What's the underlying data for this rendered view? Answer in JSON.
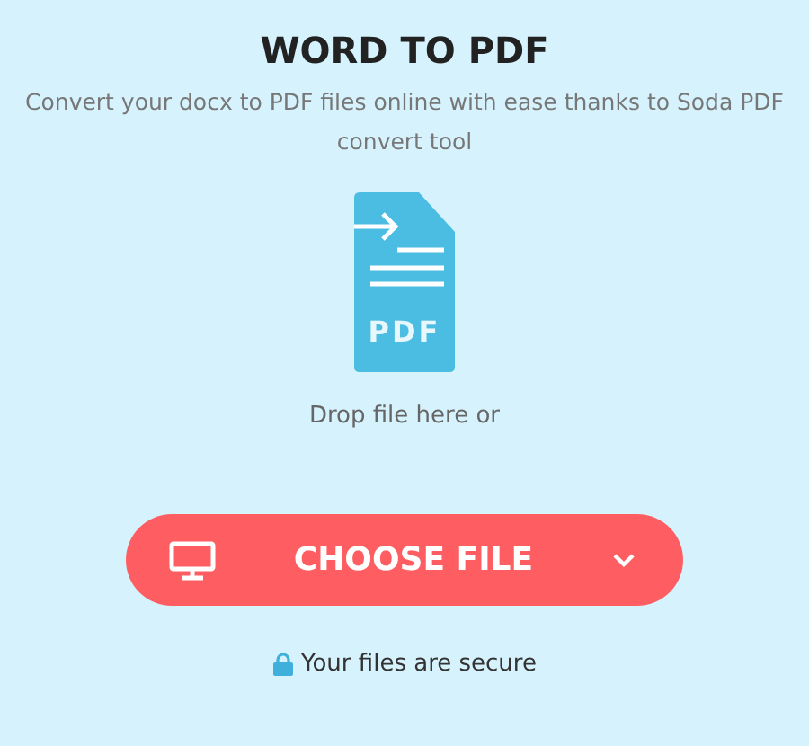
{
  "title": "WORD TO PDF",
  "subtitle": "Convert your docx to PDF files online with ease thanks to Soda PDF convert tool",
  "file_icon_label": "PDF",
  "drop_hint": "Drop file here or",
  "choose_button": {
    "label": "CHOOSE FILE"
  },
  "security_note": "Your files are secure"
}
